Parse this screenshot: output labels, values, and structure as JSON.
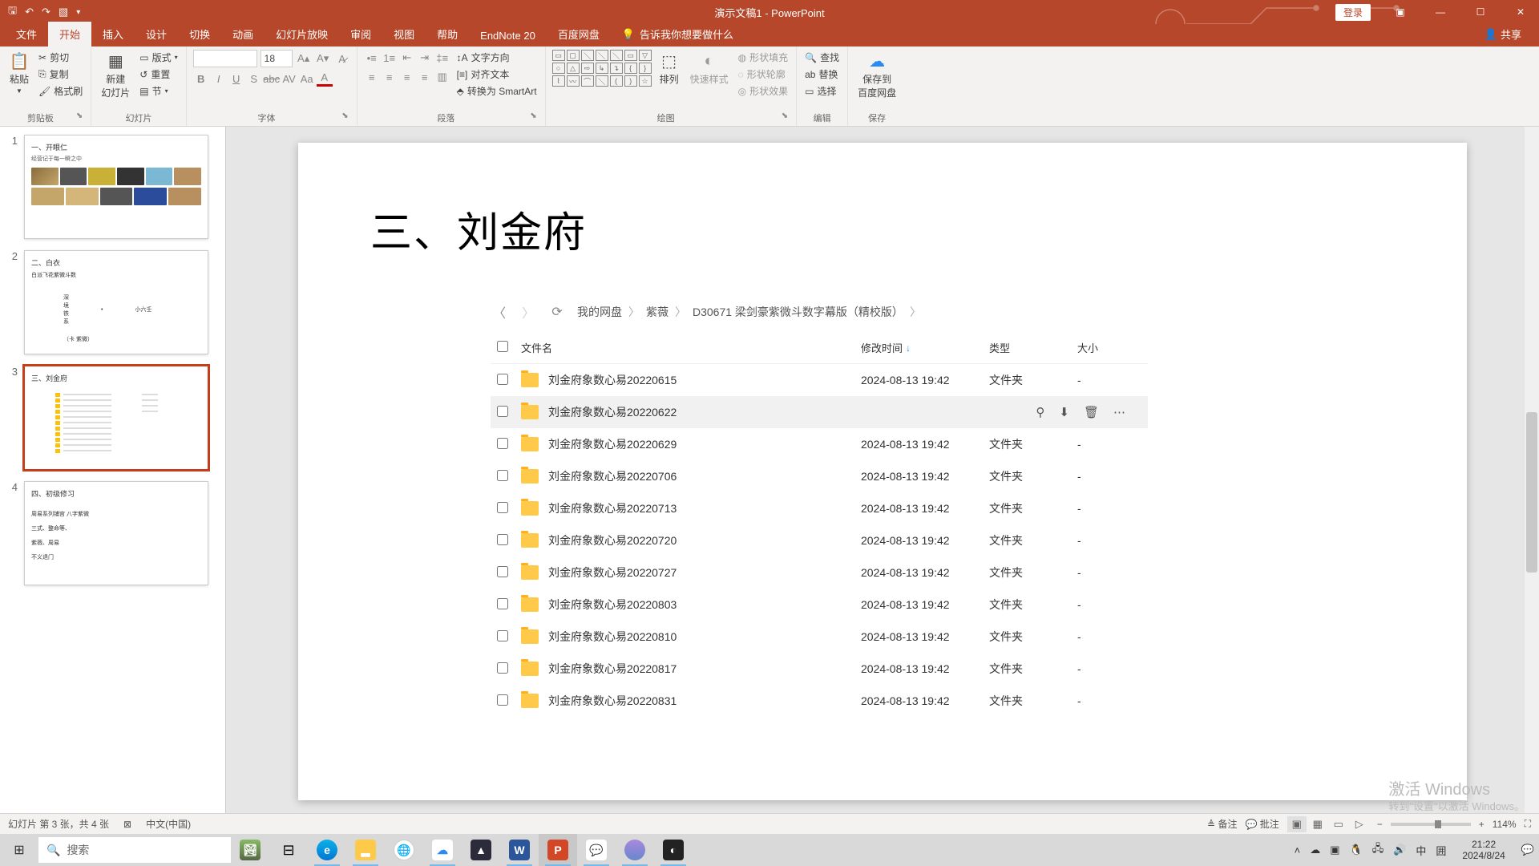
{
  "title_bar": {
    "doc_title": "演示文稿1 - PowerPoint",
    "login": "登录"
  },
  "tabs": {
    "file": "文件",
    "home": "开始",
    "insert": "插入",
    "design": "设计",
    "transitions": "切换",
    "animations": "动画",
    "slideshow": "幻灯片放映",
    "review": "审阅",
    "view": "视图",
    "help": "帮助",
    "endnote": "EndNote 20",
    "baidu": "百度网盘",
    "tellme": "告诉我你想要做什么",
    "share": "共享"
  },
  "ribbon": {
    "clipboard": {
      "paste": "粘贴",
      "cut": "剪切",
      "copy": "复制",
      "format_painter": "格式刷",
      "label": "剪贴板"
    },
    "slides": {
      "new_slide": "新建\n幻灯片",
      "layout": "版式",
      "reset": "重置",
      "section": "节",
      "label": "幻灯片"
    },
    "font": {
      "size": "18",
      "label": "字体"
    },
    "paragraph": {
      "text_dir": "文字方向",
      "align_text": "对齐文本",
      "smartart": "转换为 SmartArt",
      "label": "段落"
    },
    "drawing": {
      "arrange": "排列",
      "quick_styles": "快速样式",
      "shape_fill": "形状填充",
      "shape_outline": "形状轮廓",
      "shape_effects": "形状效果",
      "label": "绘图"
    },
    "editing": {
      "find": "查找",
      "replace": "替换",
      "select": "选择",
      "label": "编辑"
    },
    "save": {
      "save_to": "保存到\n百度网盘",
      "label": "保存"
    }
  },
  "thumbs": {
    "t1": {
      "title": "一、开眼仁",
      "sub": "经营记于每一瞬之中"
    },
    "t2": {
      "title": "二、白衣",
      "sub": "白派飞花紫微斗数",
      "l1": "深",
      "l2": "境",
      "l3": "铁",
      "l4": "系",
      "r": "小六壬",
      "foot": "（卡  紫微）"
    },
    "t3": {
      "title": "三、刘金府"
    },
    "t4": {
      "title": "四、初级修习",
      "l1": "周易系列铺宫  八字紫微",
      "l2": "三式、整命等、",
      "l3": "紫薇、周易",
      "l4": "不义退门"
    }
  },
  "slide": {
    "title": "三、刘金府",
    "nav": {
      "my_disk": "我的网盘",
      "ziwei": "紫薇",
      "folder": "D30671 梁剑豪紫微斗数字幕版（精校版）"
    },
    "cols": {
      "name": "文件名",
      "date": "修改时间",
      "type": "类型",
      "size": "大小"
    },
    "type_folder": "文件夹",
    "size_dash": "-",
    "date": "2024-08-13 19:42",
    "rows": [
      {
        "name": "刘金府象数心易20220615"
      },
      {
        "name": "刘金府象数心易20220622",
        "hovered": true
      },
      {
        "name": "刘金府象数心易20220629"
      },
      {
        "name": "刘金府象数心易20220706"
      },
      {
        "name": "刘金府象数心易20220713"
      },
      {
        "name": "刘金府象数心易20220720"
      },
      {
        "name": "刘金府象数心易20220727"
      },
      {
        "name": "刘金府象数心易20220803"
      },
      {
        "name": "刘金府象数心易20220810"
      },
      {
        "name": "刘金府象数心易20220817"
      },
      {
        "name": "刘金府象数心易20220831"
      }
    ]
  },
  "watermark": {
    "l1": "激活 Windows",
    "l2": "转到\"设置\"以激活 Windows。"
  },
  "status": {
    "slide_info": "幻灯片 第 3 张，共 4 张",
    "lang": "中文(中国)",
    "notes": "备注",
    "comments": "批注",
    "zoom": "114%"
  },
  "taskbar": {
    "search": "搜索",
    "ime": "中",
    "time": "21:22",
    "date": "2024/8/24"
  }
}
